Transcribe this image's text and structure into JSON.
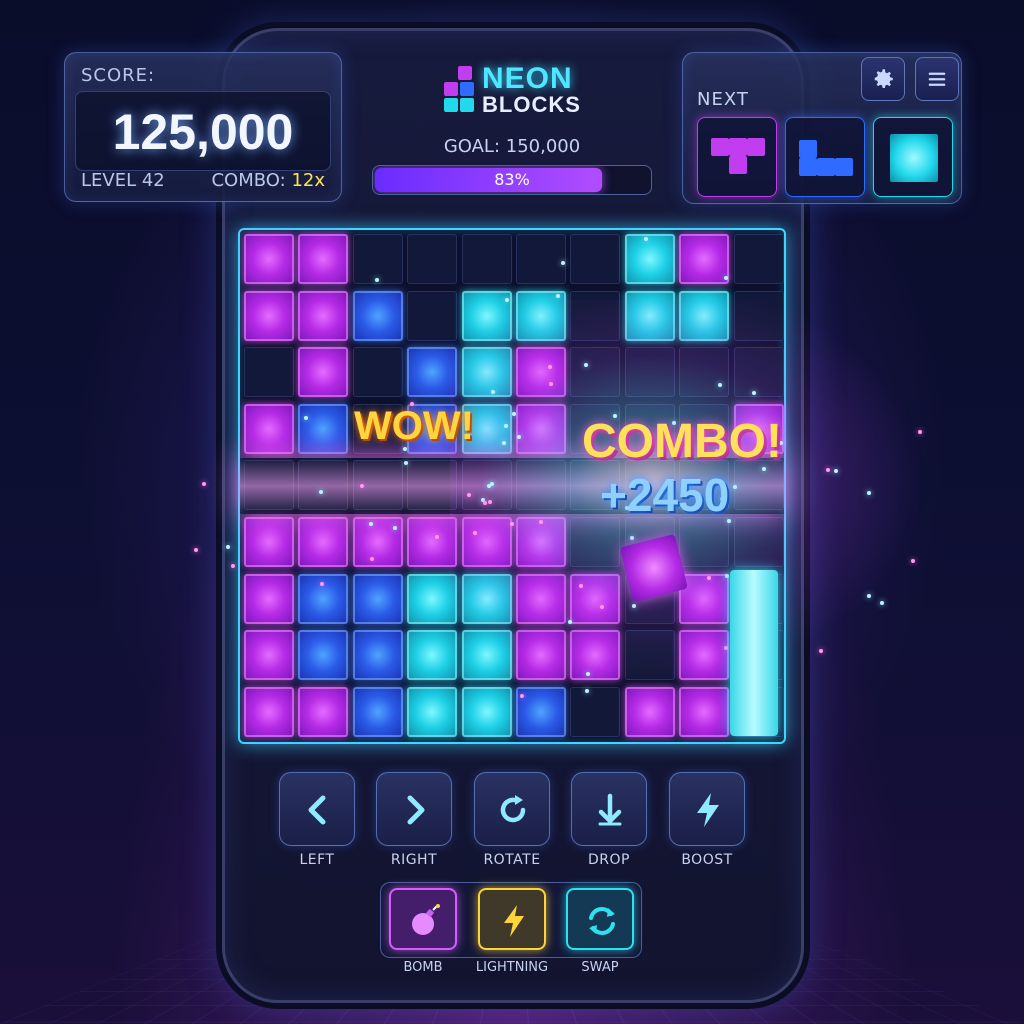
{
  "header": {
    "score_label": "SCORE:",
    "score_value": "125,000",
    "level_text": "LEVEL 42",
    "combo_label": "COMBO:",
    "combo_value": "12x"
  },
  "logo": {
    "line1": "NEON",
    "line2": "BLOCKS"
  },
  "goal": {
    "text": "GOAL: 150,000",
    "progress_percent": 83,
    "progress_text": "83%"
  },
  "next": {
    "label": "NEXT",
    "pieces": [
      {
        "shape": "T",
        "color": "#c23df0"
      },
      {
        "shape": "S",
        "color": "#2f6bff"
      },
      {
        "shape": "O",
        "color": "#22d8ec"
      }
    ]
  },
  "toolbar": {
    "settings_icon": "gear-icon",
    "menu_icon": "menu-icon"
  },
  "board": {
    "cols": 10,
    "rows": 9,
    "cells": [
      "PP.....CP.",
      "PPB.CC.CC.",
      ".P.BCP....",
      "PB.BCP...P",
      "..........",
      "PPPPPP....",
      "PBBCCPP.P.",
      "PBBCCPP.P.",
      "PPBCCB.PP."
    ],
    "colors": {
      "P": "#b52be6",
      "B": "#2b5be8",
      "C": "#1ed0e6"
    }
  },
  "effects": {
    "wow": "WOW!",
    "combo": "COMBO!",
    "bonus": "+2450"
  },
  "controls": [
    {
      "label": "LEFT",
      "icon": "chevron-left-icon"
    },
    {
      "label": "RIGHT",
      "icon": "chevron-right-icon"
    },
    {
      "label": "ROTATE",
      "icon": "rotate-icon"
    },
    {
      "label": "DROP",
      "icon": "drop-icon"
    },
    {
      "label": "BOOST",
      "icon": "lightning-icon"
    }
  ],
  "powerups": [
    {
      "label": "BOMB",
      "icon": "bomb-icon",
      "color": "#d65cff"
    },
    {
      "label": "LIGHTNING",
      "icon": "lightning-icon",
      "color": "#ffd43b"
    },
    {
      "label": "SWAP",
      "icon": "swap-icon",
      "color": "#2fe0f0"
    }
  ]
}
